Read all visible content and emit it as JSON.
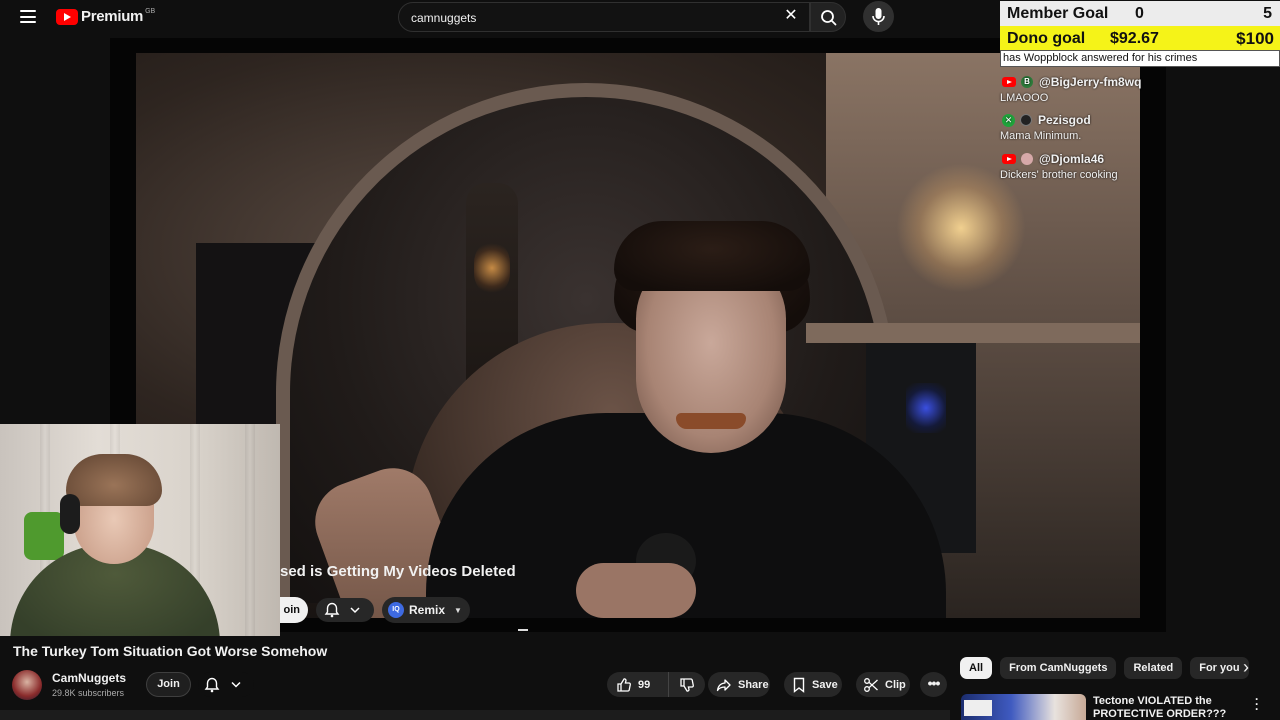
{
  "header": {
    "brand": "Premium",
    "region": "GB",
    "search_value": "camnuggets"
  },
  "player": {
    "inner_overlay_title": "sed is Getting My Videos Deleted",
    "inner_join": "oin",
    "inner_remix": "Remix"
  },
  "video": {
    "title": "The Turkey Tom Situation Got Worse Somehow",
    "channel": "CamNuggets",
    "subscribers": "29.8K subscribers",
    "join_label": "Join",
    "like_count": "99",
    "share_label": "Share",
    "save_label": "Save",
    "clip_label": "Clip"
  },
  "chips": [
    "All",
    "From CamNuggets",
    "Related",
    "For you"
  ],
  "recommendation": {
    "title": "Tectone VIOLATED the PROTECTIVE ORDER???"
  },
  "stream_goals": {
    "member_label": "Member Goal",
    "member_current": "0",
    "member_target": "5",
    "dono_label": "Dono goal",
    "dono_current": "$92.67",
    "dono_target": "$100",
    "ticker": "has Woppblock answered for his crimes"
  },
  "chat": [
    {
      "platform": "youtube",
      "avatar_letter": "B",
      "user": "@BigJerry-fm8wq",
      "text": "LMAOOO"
    },
    {
      "platform": "xbox",
      "avatar_letter": "",
      "user": "Pezisgod",
      "text": "Mama Minimum."
    },
    {
      "platform": "youtube",
      "avatar_letter": "",
      "user": "@Djomla46",
      "text": "Dickers' brother cooking"
    }
  ],
  "colors": {
    "accent_red": "#ff0000",
    "dono_yellow": "#f5f318",
    "background": "#0f0f0f"
  }
}
